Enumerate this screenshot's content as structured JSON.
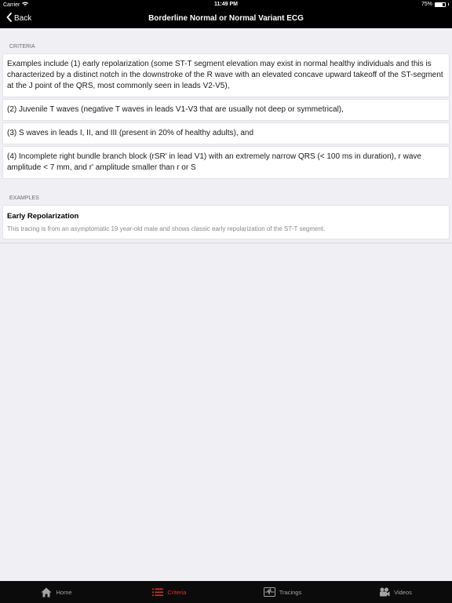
{
  "status_bar": {
    "carrier": "Carrier",
    "time": "11:49 PM",
    "battery": "75%",
    "battery_level": 0.75
  },
  "nav": {
    "back_label": "Back",
    "title": "Borderline Normal or Normal Variant ECG"
  },
  "criteria": {
    "header": "CRITERIA",
    "items": [
      "Examples include (1) early repolarization (some ST-T segment elevation may exist in normal healthy individuals and this is characterized by a distinct notch in the downstroke of the R wave with an elevated concave upward takeoff of the ST-segment at the J point of the QRS, most commonly seen in leads V2-V5),",
      "(2) Juvenile T waves (negative T waves in leads V1-V3 that are usually not deep or symmetrical),",
      "(3) S waves in leads I, II, and III (present in 20% of healthy adults), and",
      "(4) Incomplete right bundle branch block (rSR' in lead V1) with an extremely narrow QRS (< 100 ms in duration), r wave amplitude < 7 mm, and r' amplitude smaller than r or S"
    ]
  },
  "examples": {
    "header": "EXAMPLES",
    "items": [
      {
        "title": "Early Repolarization",
        "description": "This tracing is from an asymptomatic 19 year-old male and shows classic early repolarization of the ST-T segment."
      }
    ]
  },
  "tabs": [
    {
      "label": "Home",
      "icon": "home-icon",
      "active": false
    },
    {
      "label": "Criteria",
      "icon": "list-icon",
      "active": true
    },
    {
      "label": "Tracings",
      "icon": "ecg-icon",
      "active": false
    },
    {
      "label": "Videos",
      "icon": "video-camera-icon",
      "active": false
    }
  ],
  "colors": {
    "accent": "#d9312b",
    "background": "#efeff4",
    "bar": "#000000"
  }
}
